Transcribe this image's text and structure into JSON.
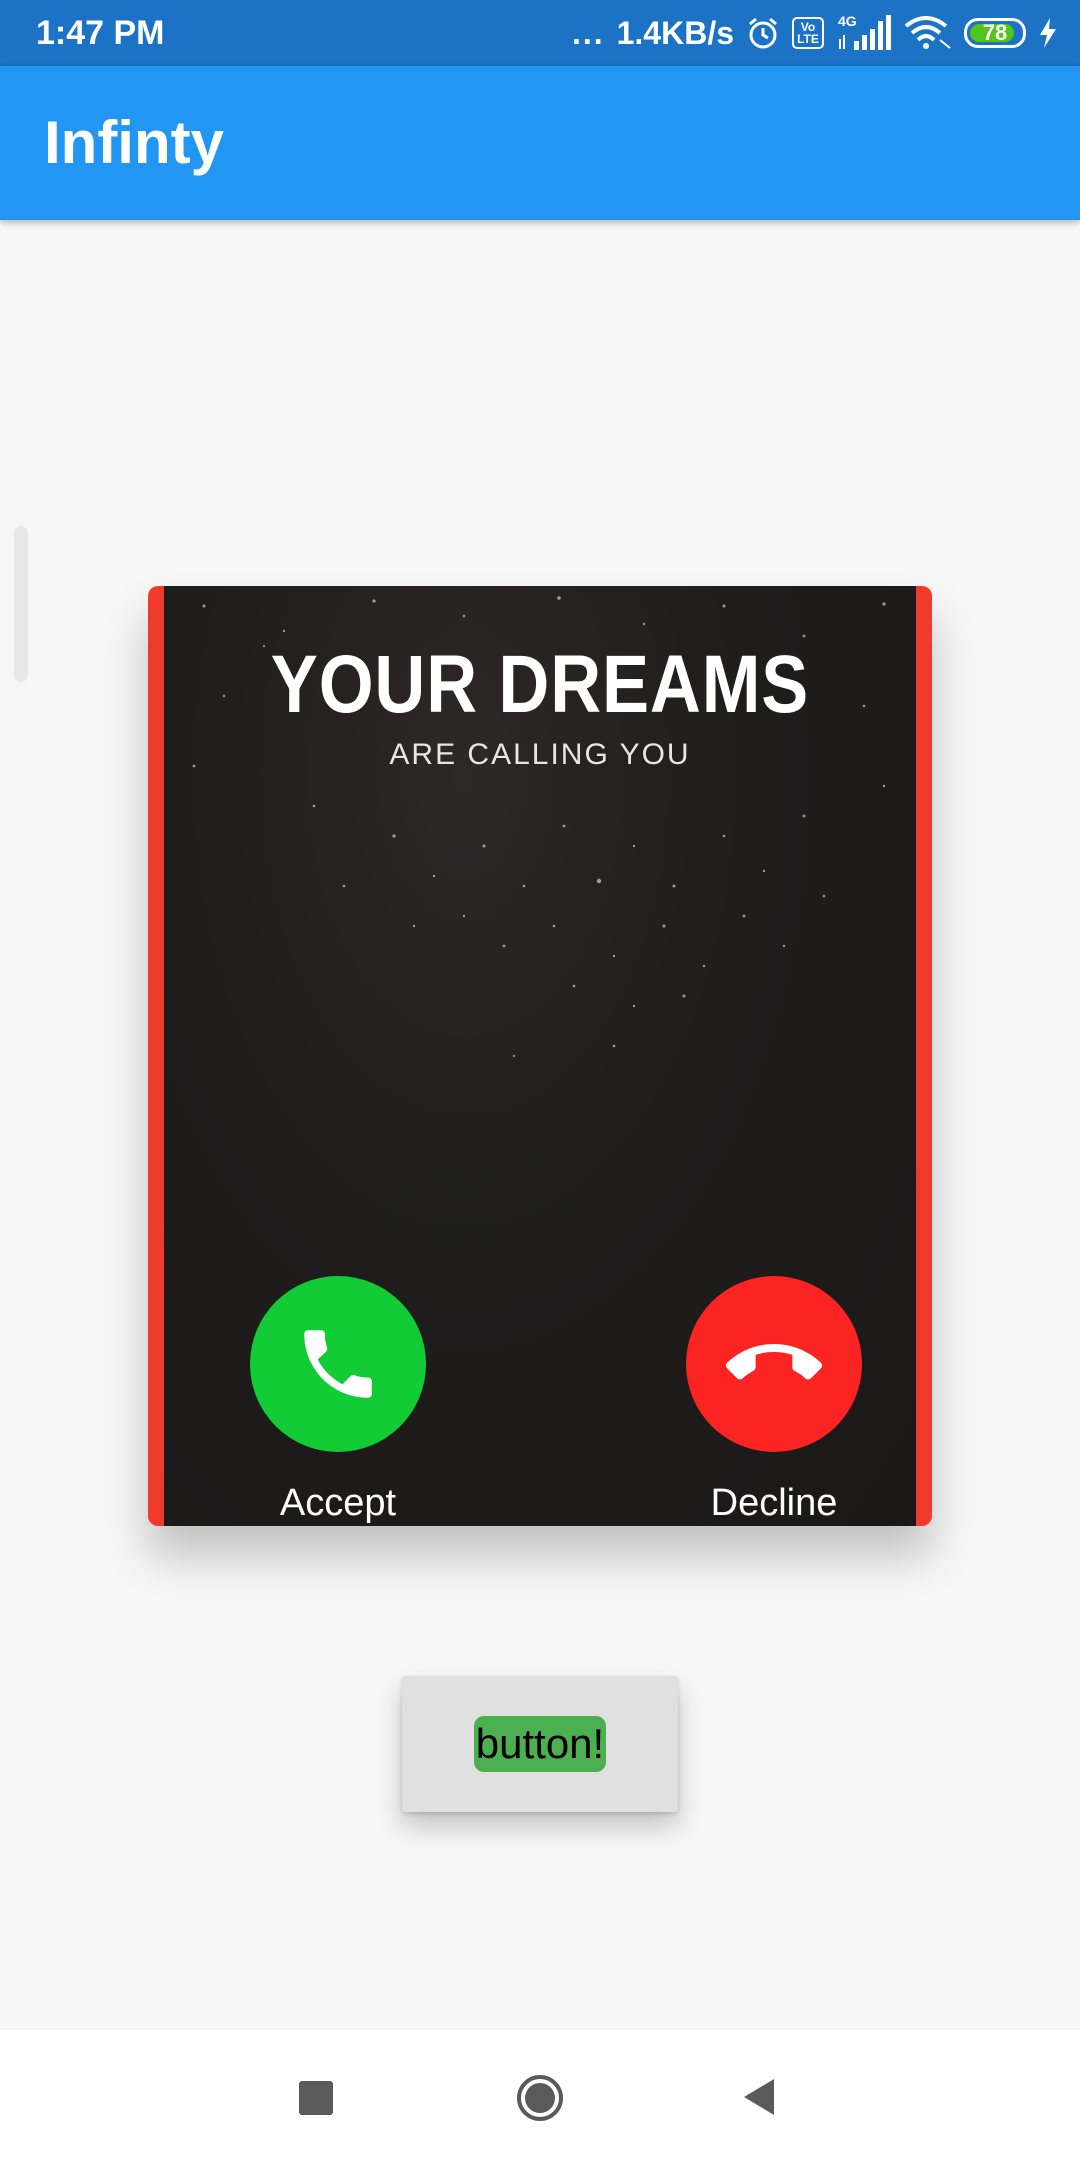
{
  "status_bar": {
    "time": "1:47 PM",
    "dots": "...",
    "net_speed": "1.4KB/s",
    "volte_top": "Vo",
    "volte_bottom": "LTE",
    "network_type": "4G",
    "battery_level": "78",
    "icons": [
      "alarm-icon",
      "volte-icon",
      "signal-icon",
      "wifi-icon",
      "battery-icon",
      "charging-icon"
    ]
  },
  "app_bar": {
    "title": "Infinty"
  },
  "call_card": {
    "headline": "YOUR DREAMS",
    "subheadline": "ARE CALLING YOU",
    "accept_label": "Accept",
    "decline_label": "Decline",
    "colors": {
      "border": "#ef3a2c",
      "accept": "#12cc36",
      "decline": "#fc2323"
    }
  },
  "action_button": {
    "label": "button!",
    "label_background": "#4caf50"
  },
  "nav_bar": {
    "icons": [
      "recents-icon",
      "home-icon",
      "back-icon"
    ]
  },
  "colors": {
    "status_bar": "#1c72c4",
    "app_bar": "#2196f3",
    "background": "#f7f7f7"
  }
}
